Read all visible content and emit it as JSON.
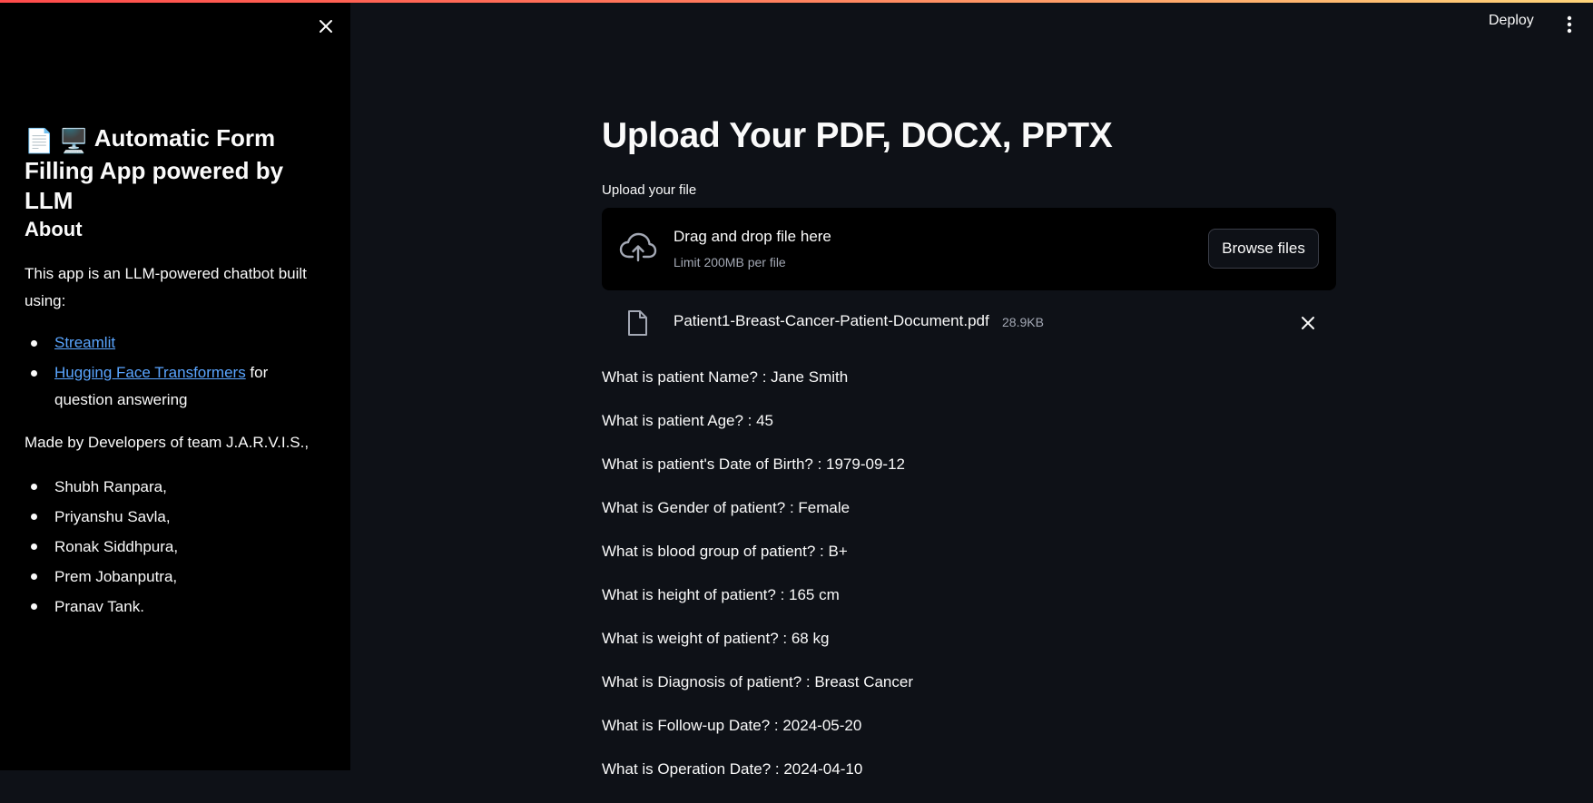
{
  "sidebar": {
    "title_emoji_1": "📄",
    "title_emoji_2": "🖥️",
    "title": "Automatic Form Filling App powered by LLM",
    "about_heading": "About",
    "about_text": "This app is an LLM-powered chatbot built using:",
    "links": [
      {
        "label": "Streamlit",
        "suffix": ""
      },
      {
        "label": "Hugging Face Transformers",
        "suffix": " for question answering"
      }
    ],
    "made_by": "Made by Developers of team J.A.R.V.I.S.,",
    "developers": [
      "Shubh Ranpara,",
      "Priyanshu Savla,",
      "Ronak Siddhpura,",
      "Prem Jobanputra,",
      "Pranav Tank."
    ]
  },
  "header": {
    "deploy_label": "Deploy"
  },
  "main": {
    "title": "Upload Your PDF, DOCX, PPTX",
    "upload_label": "Upload your file",
    "dropzone": {
      "title": "Drag and drop file here",
      "limit": "Limit 200MB per file",
      "browse_label": "Browse files"
    },
    "file": {
      "name": "Patient1-Breast-Cancer-Patient-Document.pdf",
      "size": "28.9KB"
    },
    "qa": [
      "What is patient Name? : Jane Smith",
      "What is patient Age? : 45",
      "What is patient's Date of Birth? : 1979-09-12",
      "What is Gender of patient? : Female",
      "What is blood group of patient? : B+",
      "What is height of patient? : 165 cm",
      "What is weight of patient? : 68 kg",
      "What is Diagnosis of patient? : Breast Cancer",
      "What is Follow-up Date? : 2024-05-20",
      "What is Operation Date? : 2024-04-10"
    ]
  },
  "colors": {
    "background": "#0e1117",
    "sidebar": "#000000",
    "link": "#5aa5ff",
    "accent_gradient_start": "#ff4b4b",
    "accent_gradient_end": "#ffd57a"
  }
}
